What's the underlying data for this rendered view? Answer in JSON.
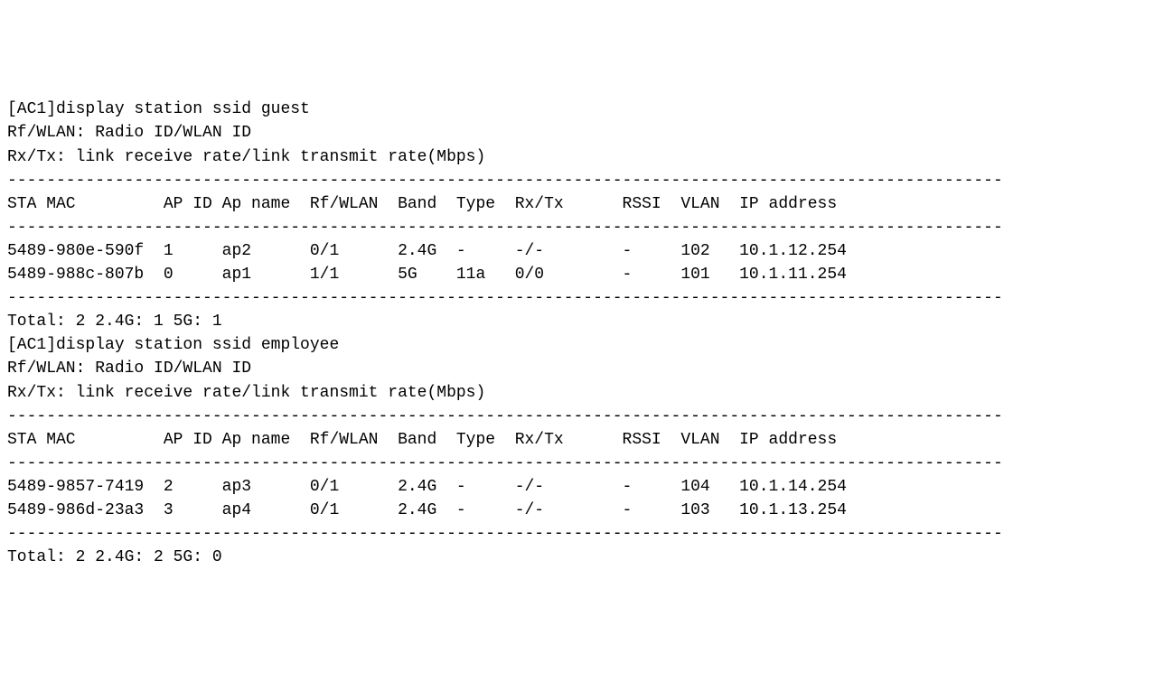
{
  "sections": [
    {
      "command": "[AC1]display station ssid guest",
      "legend": [
        "Rf/WLAN: Radio ID/WLAN ID",
        "Rx/Tx: link receive rate/link transmit rate(Mbps)"
      ],
      "headers": [
        "STA MAC",
        "AP ID",
        "Ap name",
        "Rf/WLAN",
        "Band",
        "Type",
        "Rx/Tx",
        "RSSI",
        "VLAN",
        "IP address"
      ],
      "rows": [
        {
          "sta_mac": "5489-980e-590f",
          "ap_id": "1",
          "ap_name": "ap2",
          "rf_wlan": "0/1",
          "band": "2.4G",
          "type": "-",
          "rx_tx": "-/-",
          "rssi": "-",
          "vlan": "102",
          "ip": "10.1.12.254"
        },
        {
          "sta_mac": "5489-988c-807b",
          "ap_id": "0",
          "ap_name": "ap1",
          "rf_wlan": "1/1",
          "band": "5G",
          "type": "11a",
          "rx_tx": "0/0",
          "rssi": "-",
          "vlan": "101",
          "ip": "10.1.11.254"
        }
      ],
      "totals": {
        "total": "2",
        "g24": "1",
        "g5": "1"
      }
    },
    {
      "command": "[AC1]display station ssid employee",
      "legend": [
        "Rf/WLAN: Radio ID/WLAN ID",
        "Rx/Tx: link receive rate/link transmit rate(Mbps)"
      ],
      "headers": [
        "STA MAC",
        "AP ID",
        "Ap name",
        "Rf/WLAN",
        "Band",
        "Type",
        "Rx/Tx",
        "RSSI",
        "VLAN",
        "IP address"
      ],
      "rows": [
        {
          "sta_mac": "5489-9857-7419",
          "ap_id": "2",
          "ap_name": "ap3",
          "rf_wlan": "0/1",
          "band": "2.4G",
          "type": "-",
          "rx_tx": "-/-",
          "rssi": "-",
          "vlan": "104",
          "ip": "10.1.14.254"
        },
        {
          "sta_mac": "5489-986d-23a3",
          "ap_id": "3",
          "ap_name": "ap4",
          "rf_wlan": "0/1",
          "band": "2.4G",
          "type": "-",
          "rx_tx": "-/-",
          "rssi": "-",
          "vlan": "103",
          "ip": "10.1.13.254"
        }
      ],
      "totals": {
        "total": "2",
        "g24": "2",
        "g5": "0"
      }
    }
  ],
  "chart_data": {
    "type": "table",
    "tables": [
      {
        "title": "display station ssid guest",
        "columns": [
          "STA MAC",
          "AP ID",
          "Ap name",
          "Rf/WLAN",
          "Band",
          "Type",
          "Rx/Tx",
          "RSSI",
          "VLAN",
          "IP address"
        ],
        "rows": [
          [
            "5489-980e-590f",
            "1",
            "ap2",
            "0/1",
            "2.4G",
            "-",
            "-/-",
            "-",
            "102",
            "10.1.12.254"
          ],
          [
            "5489-988c-807b",
            "0",
            "ap1",
            "1/1",
            "5G",
            "11a",
            "0/0",
            "-",
            "101",
            "10.1.11.254"
          ]
        ],
        "summary": "Total: 2 2.4G: 1 5G: 1"
      },
      {
        "title": "display station ssid employee",
        "columns": [
          "STA MAC",
          "AP ID",
          "Ap name",
          "Rf/WLAN",
          "Band",
          "Type",
          "Rx/Tx",
          "RSSI",
          "VLAN",
          "IP address"
        ],
        "rows": [
          [
            "5489-9857-7419",
            "2",
            "ap3",
            "0/1",
            "2.4G",
            "-",
            "-/-",
            "-",
            "104",
            "10.1.14.254"
          ],
          [
            "5489-986d-23a3",
            "3",
            "ap4",
            "0/1",
            "2.4G",
            "-",
            "-/-",
            "-",
            "103",
            "10.1.13.254"
          ]
        ],
        "summary": "Total: 2 2.4G: 2 5G: 0"
      }
    ]
  }
}
